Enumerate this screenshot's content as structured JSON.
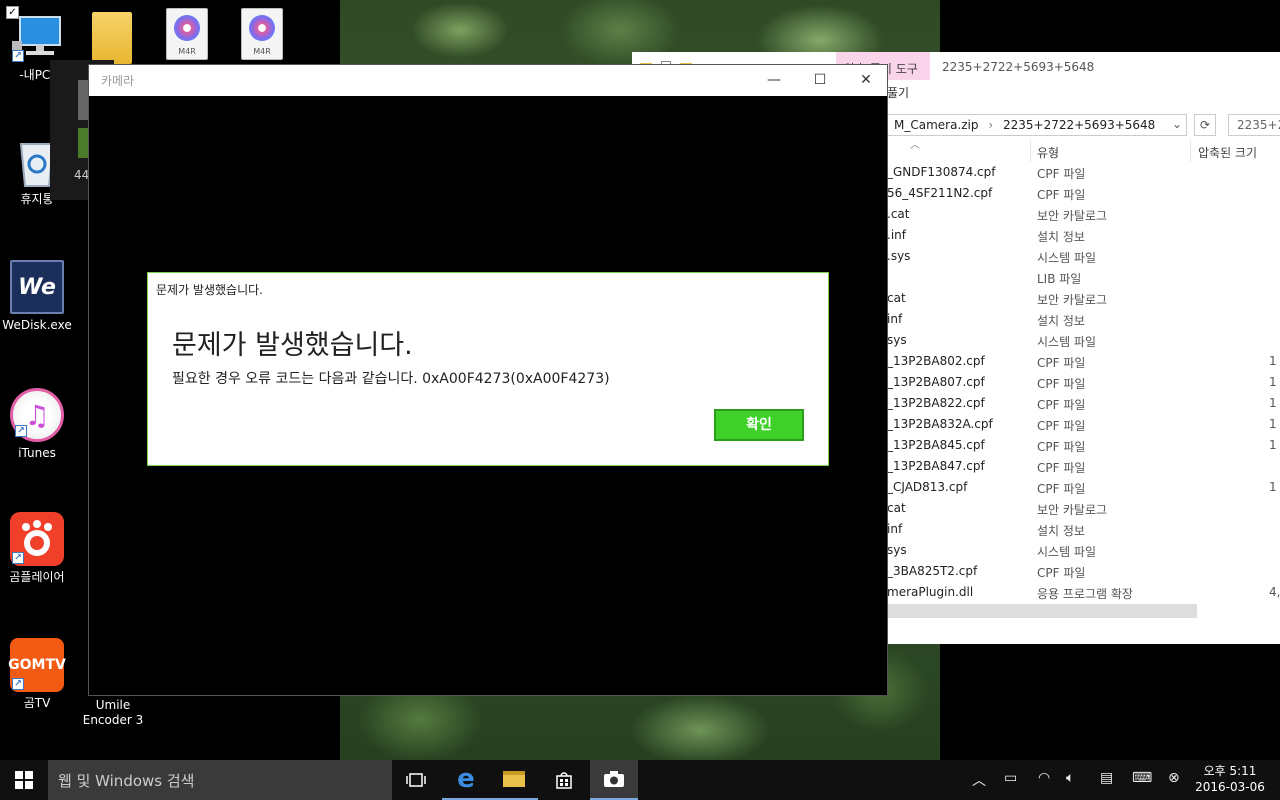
{
  "desktop": {
    "icons": [
      {
        "label": "-내PC-"
      },
      {
        "label": "휴지통"
      },
      {
        "label": "WeDisk.exe",
        "glyph": "We"
      },
      {
        "label": "iTunes"
      },
      {
        "label": "곰플레이어"
      },
      {
        "label": "곰TV",
        "glyph": "GOMTV"
      },
      {
        "label_line1": "Umile",
        "label_line2": "Encoder 3"
      }
    ],
    "file_icon_label": "M4R",
    "ghost_number": "44"
  },
  "explorer": {
    "context_tab": "압축 풀기 도구",
    "title": "2235+2722+5693+5648",
    "ribbon_tab": "풀기",
    "address": {
      "part1": "M_Camera.zip",
      "sep": "›",
      "part2": "2235+2722+5693+5648"
    },
    "search_placeholder": "2235+2",
    "columns": {
      "type": "유형",
      "compressed_size": "압축된 크기"
    },
    "rows": [
      {
        "name": "_GNDF130874.cpf",
        "type": "CPF 파일",
        "size": ""
      },
      {
        "name": "56_4SF211N2.cpf",
        "type": "CPF 파일",
        "size": ""
      },
      {
        "name": ".cat",
        "type": "보안 카탈로그",
        "size": ""
      },
      {
        "name": ".inf",
        "type": "설치 정보",
        "size": ""
      },
      {
        "name": ".sys",
        "type": "시스템 파일",
        "size": ""
      },
      {
        "name": "",
        "type": "LIB 파일",
        "size": ""
      },
      {
        "name": "cat",
        "type": "보안 카탈로그",
        "size": ""
      },
      {
        "name": "inf",
        "type": "설치 정보",
        "size": ""
      },
      {
        "name": "sys",
        "type": "시스템 파일",
        "size": ""
      },
      {
        "name": "_13P2BA802.cpf",
        "type": "CPF 파일",
        "size": "1"
      },
      {
        "name": "_13P2BA807.cpf",
        "type": "CPF 파일",
        "size": "1"
      },
      {
        "name": "_13P2BA822.cpf",
        "type": "CPF 파일",
        "size": "1"
      },
      {
        "name": "_13P2BA832A.cpf",
        "type": "CPF 파일",
        "size": "1"
      },
      {
        "name": "_13P2BA845.cpf",
        "type": "CPF 파일",
        "size": "1"
      },
      {
        "name": "_13P2BA847.cpf",
        "type": "CPF 파일",
        "size": ""
      },
      {
        "name": "_CJAD813.cpf",
        "type": "CPF 파일",
        "size": "1"
      },
      {
        "name": "cat",
        "type": "보안 카탈로그",
        "size": ""
      },
      {
        "name": "inf",
        "type": "설치 정보",
        "size": ""
      },
      {
        "name": "sys",
        "type": "시스템 파일",
        "size": ""
      },
      {
        "name": "_3BA825T2.cpf",
        "type": "CPF 파일",
        "size": ""
      },
      {
        "name": "meraPlugin.dll",
        "type": "응용 프로그램 확장",
        "size": "4,2"
      }
    ]
  },
  "camera": {
    "title": "카메라",
    "minimize": "—",
    "maximize": "☐",
    "close": "✕"
  },
  "dialog": {
    "small_title": "문제가 발생했습니다.",
    "heading": "문제가 발생했습니다.",
    "message": "필요한 경우 오류 코드는 다음과 같습니다. 0xA00F4273(0xA00F4273)",
    "ok_label": "확인"
  },
  "taskbar": {
    "search_placeholder": "웹 및 Windows 검색",
    "clock": {
      "time": "오후 5:11",
      "date": "2016-03-06"
    }
  },
  "colors": {
    "accent_green": "#3fd12a",
    "dialog_border": "#7bd44a",
    "taskbar": "#101010"
  }
}
